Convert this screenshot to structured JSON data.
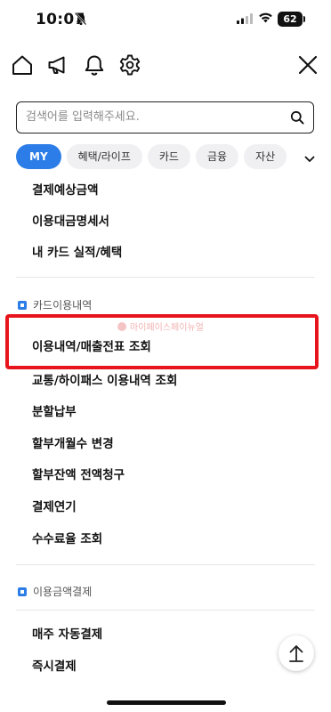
{
  "status_bar": {
    "time": "10:07",
    "battery": "62"
  },
  "search": {
    "placeholder": "검색어를 입력해주세요."
  },
  "tabs": [
    {
      "label": "MY",
      "active": true
    },
    {
      "label": "혜택/라이프"
    },
    {
      "label": "카드"
    },
    {
      "label": "금융"
    },
    {
      "label": "자산"
    }
  ],
  "menu": {
    "group1": [
      "결제예상금액",
      "이용대금명세서",
      "내 카드 실적/혜택"
    ],
    "section_card_usage": {
      "title": "카드이용내역",
      "items": [
        "이용내역/매출전표 조회",
        "교통/하이패스 이용내역 조회",
        "분할납부",
        "할부개월수 변경",
        "할부잔액 전액청구",
        "결제연기",
        "수수료율 조회"
      ]
    },
    "section_payment": {
      "title": "이용금액결제",
      "items": [
        "매주 자동결제",
        "즉시결제"
      ]
    }
  },
  "watermark": "마이페이스페이뉴얼",
  "colors": {
    "accent": "#2c7de7",
    "highlight": "#e8141b"
  }
}
